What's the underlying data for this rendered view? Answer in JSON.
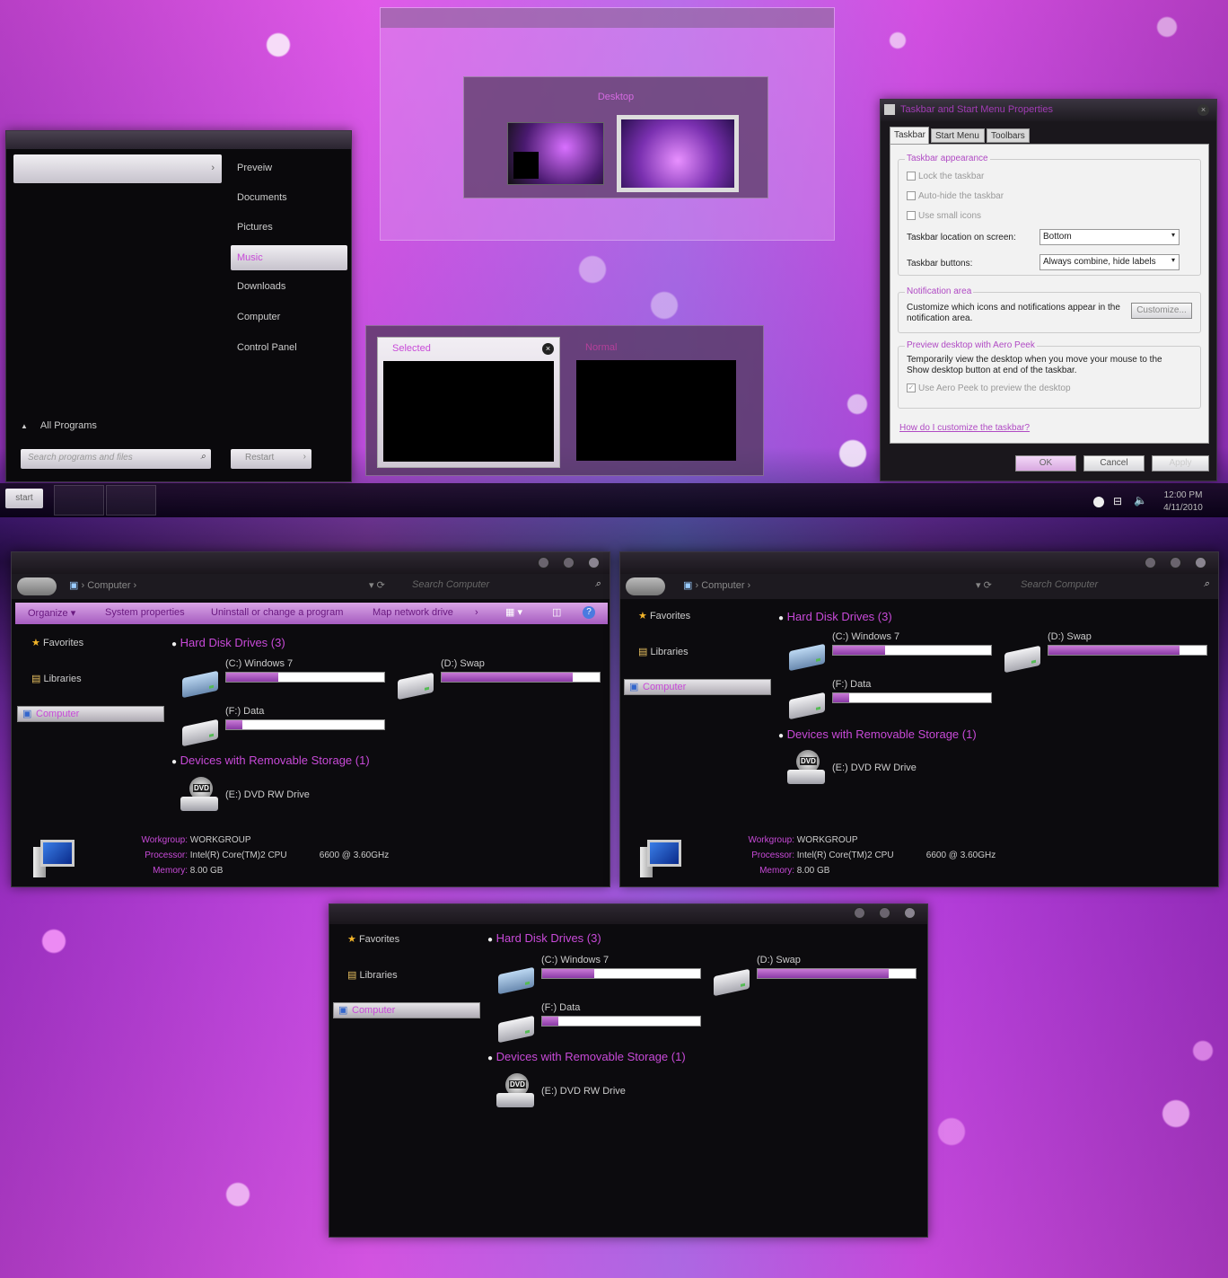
{
  "start_menu": {
    "right_items": [
      "Preveiw",
      "Documents",
      "Pictures",
      "Music",
      "Downloads",
      "Computer",
      "Control Panel"
    ],
    "selected_item": "Music",
    "all_programs": "All Programs",
    "search_placeholder": "Search programs and files",
    "restart_label": "Restart"
  },
  "desktop_preview": {
    "label": "Desktop"
  },
  "thumb_preview": {
    "selected_label": "Selected",
    "normal_label": "Normal"
  },
  "taskbar": {
    "start_label": "start",
    "time": "12:00 PM",
    "date": "4/11/2010"
  },
  "dialog": {
    "title": "Taskbar and Start Menu Properties",
    "tabs": [
      "Taskbar",
      "Start Menu",
      "Toolbars"
    ],
    "group_appearance": "Taskbar appearance",
    "lock": "Lock the taskbar",
    "autohide": "Auto-hide the taskbar",
    "small_icons": "Use small icons",
    "location_label": "Taskbar location on screen:",
    "location_value": "Bottom",
    "buttons_label": "Taskbar buttons:",
    "buttons_value": "Always combine, hide labels",
    "group_notification": "Notification area",
    "notification_text": "Customize which icons and notifications appear in the notification area.",
    "customize": "Customize...",
    "group_peek": "Preview desktop with Aero Peek",
    "peek_text": "Temporarily view the desktop when you move your mouse to the Show desktop button at end of the taskbar.",
    "peek_check": "Use Aero Peek to preview the desktop",
    "help_link": "How do I customize the taskbar?",
    "ok": "OK",
    "cancel": "Cancel",
    "apply": "Apply"
  },
  "explorer": {
    "breadcrumb": "Computer",
    "search_placeholder": "Search Computer",
    "toolbar": [
      "Organize",
      "System properties",
      "Uninstall or change a program",
      "Map network drive"
    ],
    "nav": {
      "favorites": "Favorites",
      "libraries": "Libraries",
      "computer": "Computer"
    },
    "hdd_header": "Hard Disk Drives (3)",
    "drives": [
      {
        "label": "(C:) Windows 7",
        "fill": 0.33
      },
      {
        "label": "(D:) Swap",
        "fill": 0.83
      },
      {
        "label": "(F:) Data",
        "fill": 0.1
      }
    ],
    "removable_header": "Devices with Removable Storage (1)",
    "dvd_label": "(E:) DVD RW Drive",
    "dvd_icon_text": "DVD",
    "details": {
      "workgroup_key": "Workgroup:",
      "workgroup_val": "WORKGROUP",
      "processor_key": "Processor:",
      "processor_val": "Intel(R) Core(TM)2 CPU",
      "processor_model": "6600  @ 3.60GHz",
      "memory_key": "Memory:",
      "memory_val": "8.00 GB"
    }
  }
}
